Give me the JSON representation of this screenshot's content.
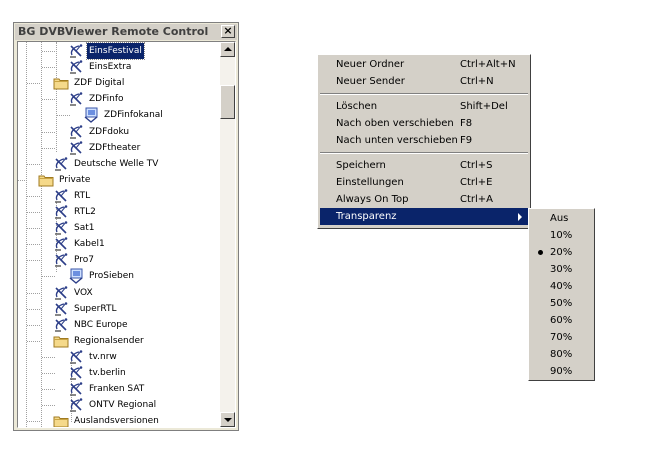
{
  "window": {
    "title": "BG DVBViewer Remote Control",
    "close_glyph": "×"
  },
  "tree": [
    {
      "label": "EinsFestival",
      "icon": "satellite-dish-icon",
      "selected": true
    },
    {
      "label": "EinsExtra",
      "icon": "satellite-dish-icon"
    },
    {
      "label": "ZDF Digital",
      "icon": "folder-icon"
    },
    {
      "label": "ZDFinfo",
      "icon": "satellite-dish-icon"
    },
    {
      "label": "ZDFinfokanal",
      "icon": "tv-channel-icon"
    },
    {
      "label": "ZDFdoku",
      "icon": "satellite-dish-icon"
    },
    {
      "label": "ZDFtheater",
      "icon": "satellite-dish-icon"
    },
    {
      "label": "Deutsche Welle TV",
      "icon": "satellite-dish-icon"
    },
    {
      "label": "Private",
      "icon": "folder-icon"
    },
    {
      "label": "RTL",
      "icon": "satellite-dish-icon"
    },
    {
      "label": "RTL2",
      "icon": "satellite-dish-icon"
    },
    {
      "label": "Sat1",
      "icon": "satellite-dish-icon"
    },
    {
      "label": "Kabel1",
      "icon": "satellite-dish-icon"
    },
    {
      "label": "Pro7",
      "icon": "satellite-dish-icon"
    },
    {
      "label": "ProSieben",
      "icon": "tv-channel-icon"
    },
    {
      "label": "VOX",
      "icon": "satellite-dish-icon"
    },
    {
      "label": "SuperRTL",
      "icon": "satellite-dish-icon"
    },
    {
      "label": "NBC Europe",
      "icon": "satellite-dish-icon"
    },
    {
      "label": "Regionalsender",
      "icon": "folder-icon"
    },
    {
      "label": "tv.nrw",
      "icon": "satellite-dish-icon"
    },
    {
      "label": "tv.berlin",
      "icon": "satellite-dish-icon"
    },
    {
      "label": "Franken SAT",
      "icon": "satellite-dish-icon"
    },
    {
      "label": "ONTV Regional",
      "icon": "satellite-dish-icon"
    },
    {
      "label": "Auslandsversionen",
      "icon": "folder-icon"
    }
  ],
  "context_menu": {
    "items": [
      {
        "label": "Neuer Ordner",
        "shortcut": "Ctrl+Alt+N"
      },
      {
        "label": "Neuer Sender",
        "shortcut": "Ctrl+N"
      },
      {
        "label": "Löschen",
        "shortcut": "Shift+Del"
      },
      {
        "label": "Nach oben verschieben",
        "shortcut": "F8"
      },
      {
        "label": "Nach unten verschieben",
        "shortcut": "F9"
      },
      {
        "label": "Speichern",
        "shortcut": "Ctrl+S"
      },
      {
        "label": "Einstellungen",
        "shortcut": "Ctrl+E"
      },
      {
        "label": "Always On Top",
        "shortcut": "Ctrl+A"
      },
      {
        "label": "Transparenz",
        "shortcut": ""
      }
    ]
  },
  "transparency_menu": {
    "items": [
      "Aus",
      "10%",
      "20%",
      "30%",
      "40%",
      "50%",
      "60%",
      "70%",
      "80%",
      "90%"
    ],
    "selected": "20%"
  },
  "colors": {
    "selection": "#0a246a",
    "menu_face": "#d4d0c8",
    "folder": "#f5d98a",
    "dish": "#2c3e88"
  }
}
